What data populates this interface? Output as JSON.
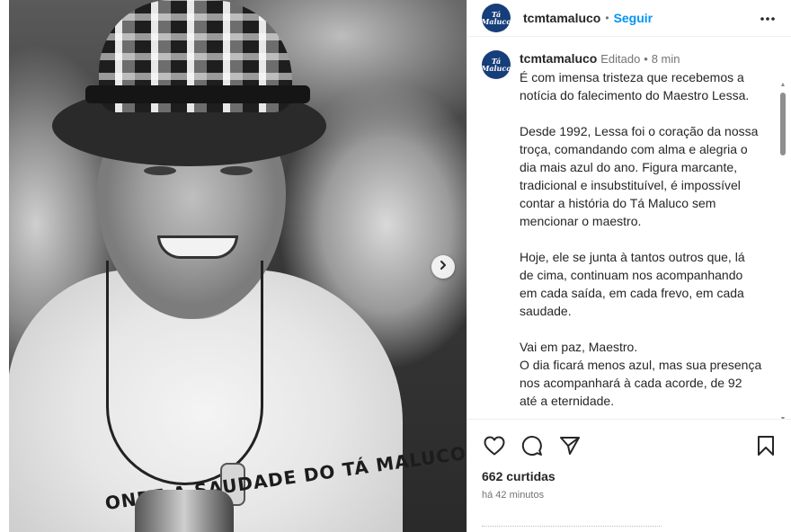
{
  "post_image": {
    "shirt_text": "ONDE A SAUDADE DO TÁ MALUCO",
    "next_button_icon": "chevron-right-icon"
  },
  "header": {
    "avatar_text": "Tá Maluco",
    "username": "tcmtamaluco",
    "separator": "•",
    "follow_label": "Seguir",
    "more_icon": "more-horizontal-icon"
  },
  "caption": {
    "username": "tcmtamaluco",
    "edited_label": "Editado",
    "separator": "•",
    "time": "8 min",
    "paragraphs": [
      "É com imensa tristeza que recebemos a notícia do falecimento do Maestro Lessa.",
      "Desde 1992, Lessa foi o coração da nossa troça, comandando com alma e alegria o dia mais azul do ano. Figura marcante, tradicional e insubstituível, é impossível contar a história do Tá Maluco sem mencionar o maestro.",
      "Hoje, ele se junta à tantos outros que, lá de cima, continuam nos acompanhando em cada saída, em cada frevo, em cada saudade.",
      "Vai em paz, Maestro.",
      "O dia ficará menos azul, mas sua presença nos acompanhará à cada acorde, de 92 até a eternidade."
    ]
  },
  "actions": {
    "like_icon": "heart-icon",
    "comment_icon": "comment-icon",
    "share_icon": "send-icon",
    "save_icon": "bookmark-icon"
  },
  "likes": "662 curtidas",
  "timestamp": "há 42 minutos",
  "colors": {
    "link_blue": "#0095f6",
    "avatar_navy": "#163e7a",
    "text": "#262626",
    "muted": "#737373"
  }
}
